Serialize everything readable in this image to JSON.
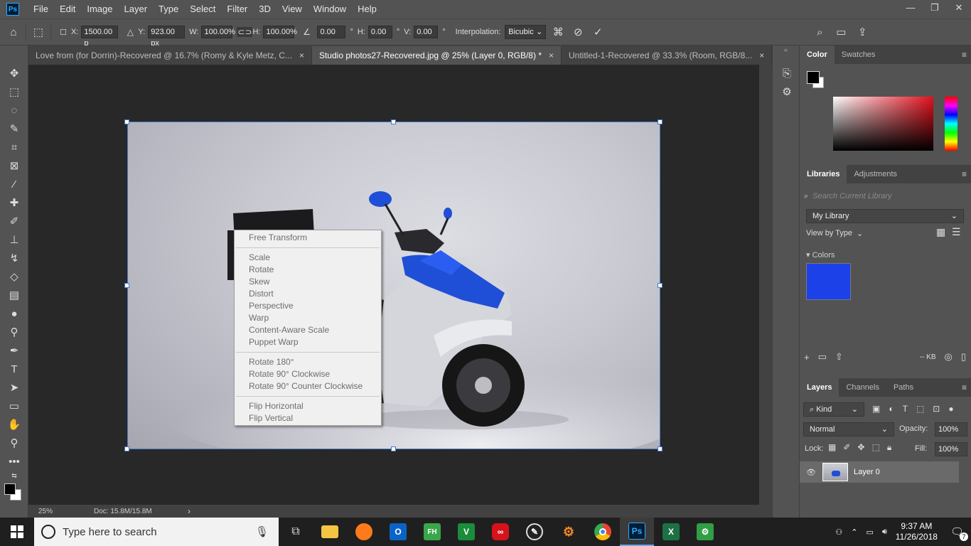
{
  "app": {
    "logo_text": "Ps"
  },
  "menu": [
    "File",
    "Edit",
    "Image",
    "Layer",
    "Type",
    "Select",
    "Filter",
    "3D",
    "View",
    "Window",
    "Help"
  ],
  "window_controls": {
    "minimize": "—",
    "restore": "❐",
    "close": "✕"
  },
  "options": {
    "x_label": "X:",
    "x_value": "1500.00 p",
    "y_label": "Y:",
    "y_value": "923.00 px",
    "w_label": "W:",
    "w_value": "100.00%",
    "h_label": "H:",
    "h_value": "100.00%",
    "angle_value": "0.00",
    "angle_unit": "°",
    "hskew_label": "H:",
    "hskew_value": "0.00",
    "hskew_unit": "°",
    "vskew_label": "V:",
    "vskew_value": "0.00",
    "vskew_unit": "°",
    "interp_label": "Interpolation:",
    "interp_value": "Bicubic"
  },
  "tabs": [
    {
      "label": "Love from (for Dorrin)-Recovered @ 16.7% (Romy & Kyle Metz, C...",
      "close": "×"
    },
    {
      "label": "Studio photos27-Recovered.jpg @ 25% (Layer 0, RGB/8) *",
      "close": "×"
    },
    {
      "label": "Untitled-1-Recovered @ 33.3% (Room, RGB/8...",
      "close": "×"
    }
  ],
  "status": {
    "zoom": "25%",
    "doc": "Doc: 15.8M/15.8M",
    "arrow": "›"
  },
  "context_menu": {
    "free_transform": "Free Transform",
    "group1": [
      "Scale",
      "Rotate",
      "Skew",
      "Distort",
      "Perspective",
      "Warp",
      "Content-Aware Scale",
      "Puppet Warp"
    ],
    "group2": [
      "Rotate 180°",
      "Rotate 90° Clockwise",
      "Rotate 90° Counter Clockwise"
    ],
    "group3": [
      "Flip Horizontal",
      "Flip Vertical"
    ]
  },
  "color_panel": {
    "tabs": [
      "Color",
      "Swatches"
    ],
    "foreground": "#000000",
    "background": "#ffffff"
  },
  "libraries": {
    "tabs": [
      "Libraries",
      "Adjustments"
    ],
    "search_placeholder": "Search Current Library",
    "library": "My Library",
    "view_by": "View by Type",
    "colors_header": "Colors",
    "swatch": "#1d41e8",
    "size": "-- KB"
  },
  "layers": {
    "tabs": [
      "Layers",
      "Channels",
      "Paths"
    ],
    "kind": "Kind",
    "blend": "Normal",
    "opacity_label": "Opacity:",
    "opacity": "100%",
    "lock_label": "Lock:",
    "fill_label": "Fill:",
    "fill": "100%",
    "layer_name": "Layer 0"
  },
  "taskbar": {
    "search_placeholder": "Type here to search",
    "time": "9:37 AM",
    "date": "11/26/2018",
    "notification_count": "7"
  }
}
